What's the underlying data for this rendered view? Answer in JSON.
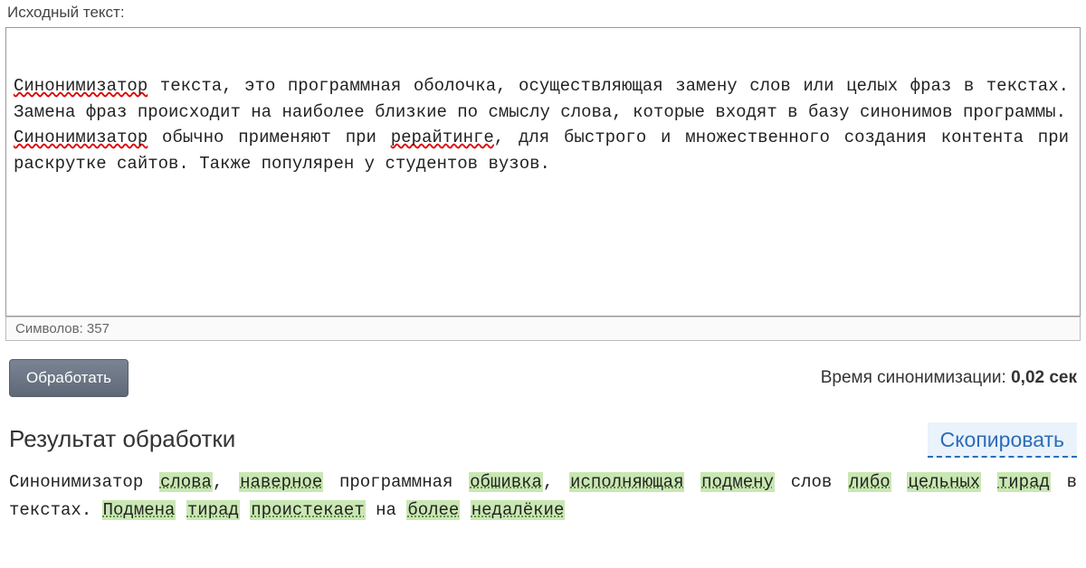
{
  "input": {
    "label": "Исходный текст:",
    "paragraph1_word1": "Синонимизатор",
    "paragraph1_rest": " текста, это программная оболочка, осуществляющая замену слов или целых фраз в текстах. Замена фраз происходит на наиболее близкие по смыслу слова, которые входят в базу синонимов программы.",
    "paragraph2_word1": "Синонимизатор",
    "paragraph2_mid": " обычно применяют при ",
    "paragraph2_word2": "рерайтинге",
    "paragraph2_rest": ", для быстрого и множественного создания контента при раскрутке сайтов. Также популярен у студентов вузов."
  },
  "counter": {
    "label": "Символов:",
    "value": "357"
  },
  "actions": {
    "process_label": "Обработать",
    "timing_label": "Время синонимизации: ",
    "timing_value": "0,02 сек"
  },
  "result": {
    "title": "Результат обработки",
    "copy_label": "Скопировать",
    "segments": {
      "s0": "Синонимизатор ",
      "s1": "слова",
      "s2": ", ",
      "s3": "наверное",
      "s4": " программная ",
      "s5": "обшивка",
      "s6": ", ",
      "s7": "исполняющая",
      "s8": " ",
      "s9": "подмену",
      "s10": " слов ",
      "s11": "либо",
      "s12": " ",
      "s13": "цельных",
      "s14": " ",
      "s15": "тирад",
      "s16": " в текстах. ",
      "s17": "Подмена",
      "s18": " ",
      "s19": "тирад",
      "s20": " ",
      "s21": "проистекает",
      "s22": " на ",
      "s23": "более",
      "s24": " ",
      "s25": "недалёкие"
    }
  }
}
